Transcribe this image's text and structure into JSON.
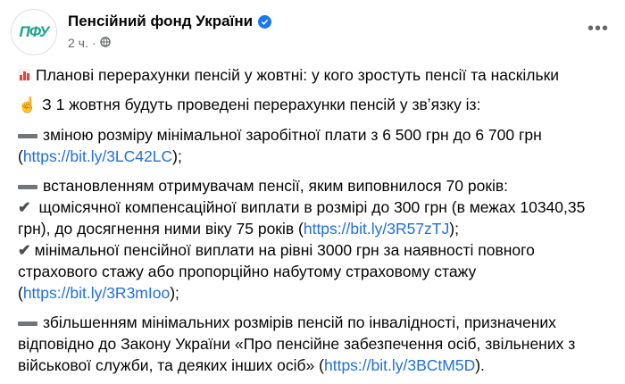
{
  "post": {
    "page_name": "Пенсійний фонд України",
    "avatar_text": "ПФУ",
    "time": "2 ч.",
    "meta_separator": "·"
  },
  "content": {
    "headline": "Планові перерахунки пенсій у жовтні: у кого зростуть пенсії та наскільки",
    "intro": "З 1 жовтня будуть проведені перерахунки пенсій у звʼязку із:",
    "item1_text": "зміною розміру мінімальної заробітної плати з 6 500 грн до 6 700 грн (",
    "item1_link": "https://bit.ly/3LC42LC",
    "item1_end": ");",
    "item2_text": "встановленням отримувачам пенсії, яким виповнилося 70 років:",
    "item2a_text": " щомісячної компенсаційної виплати в розмірі до 300 грн (в межах 10340,35 грн), до досягнення ними віку 75 років (",
    "item2a_link": "https://bit.ly/3R57zTJ",
    "item2a_end": ");",
    "item2b_text": "мінімальної пенсійної виплати на рівні 3000 грн за наявності повного страхового стажу або пропорційно набутому страховому стажу (",
    "item2b_link": "https://bit.ly/3R3mIoo",
    "item2b_end": ");",
    "item3_text": "збільшенням мінімальних розмірів пенсій по інвалідності, призначених відповідно до Закону України «Про пенсійне забезпечення осіб, звільнених з військової служби, та деяких інших осіб» (",
    "item3_link": "https://bit.ly/3BCtM5D",
    "item3_end": ")."
  },
  "icons": {
    "verified": "verified-badge-icon",
    "globe": "globe-icon",
    "more": "more-options-icon",
    "chart": "bar-chart-emoji-icon",
    "finger": "pointing-up-emoji-icon",
    "dash": "heavy-minus-emoji-icon",
    "check": "check-mark-emoji-icon"
  },
  "colors": {
    "link": "#216fdb",
    "verified": "#1877f2",
    "avatar_text": "#1aa38a",
    "secondary_text": "#65676b"
  }
}
